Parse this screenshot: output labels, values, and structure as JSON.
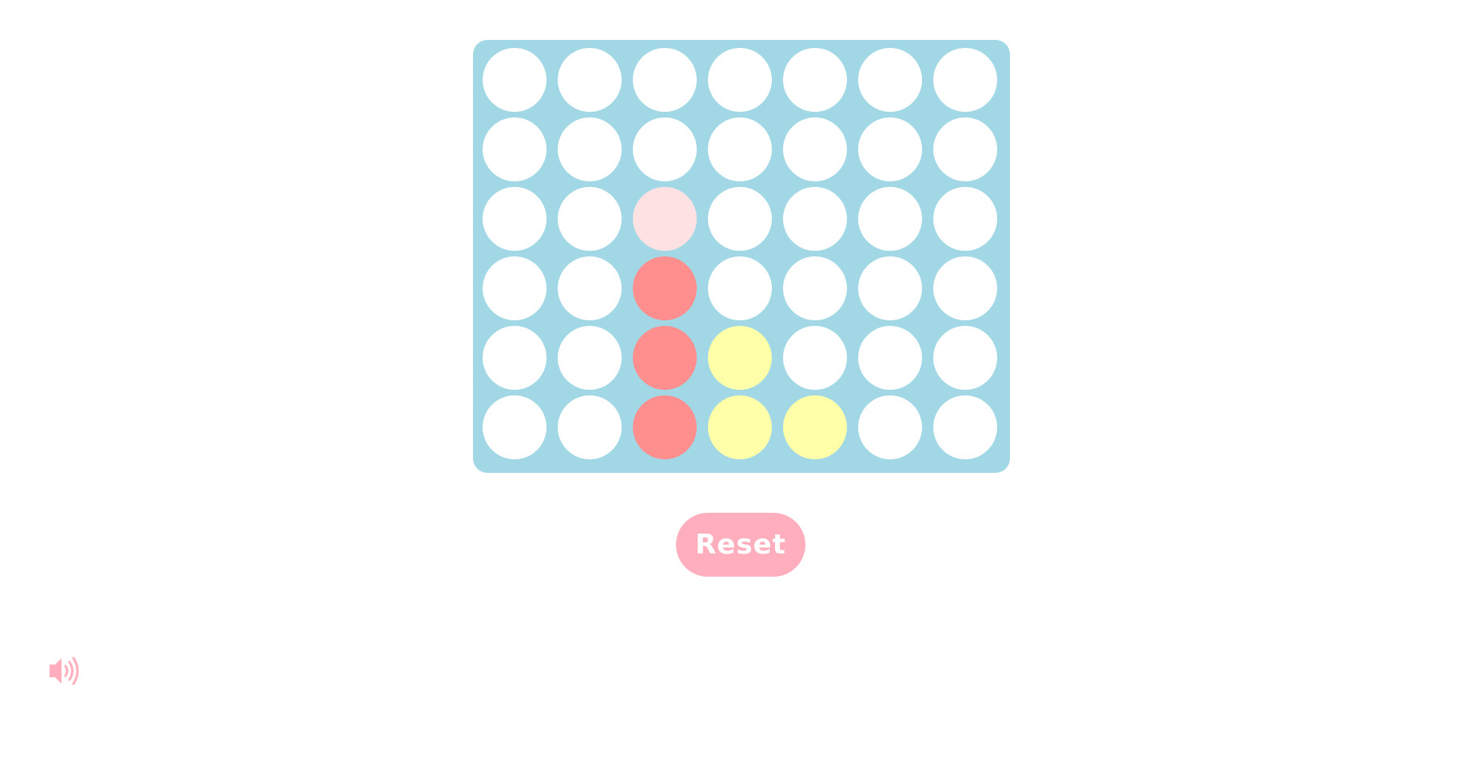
{
  "colors": {
    "board": "#a2d8e6",
    "empty": "#ffffff",
    "red": "#ff8e8e",
    "yellow": "#ffffaa",
    "red_preview": "#fde1e3",
    "button": "#ffaebd",
    "icon": "#ffaebd"
  },
  "board": {
    "columns": 7,
    "rows": 6,
    "grid": [
      [
        "empty",
        "empty",
        "empty",
        "empty",
        "empty",
        "empty",
        "empty"
      ],
      [
        "empty",
        "empty",
        "empty",
        "empty",
        "empty",
        "empty",
        "empty"
      ],
      [
        "empty",
        "empty",
        "red_preview",
        "empty",
        "empty",
        "empty",
        "empty"
      ],
      [
        "empty",
        "empty",
        "red",
        "empty",
        "empty",
        "empty",
        "empty"
      ],
      [
        "empty",
        "empty",
        "red",
        "yellow",
        "empty",
        "empty",
        "empty"
      ],
      [
        "empty",
        "empty",
        "red",
        "yellow",
        "yellow",
        "empty",
        "empty"
      ]
    ]
  },
  "controls": {
    "reset_label": "Reset",
    "sound_icon": "speaker-volume-icon"
  }
}
